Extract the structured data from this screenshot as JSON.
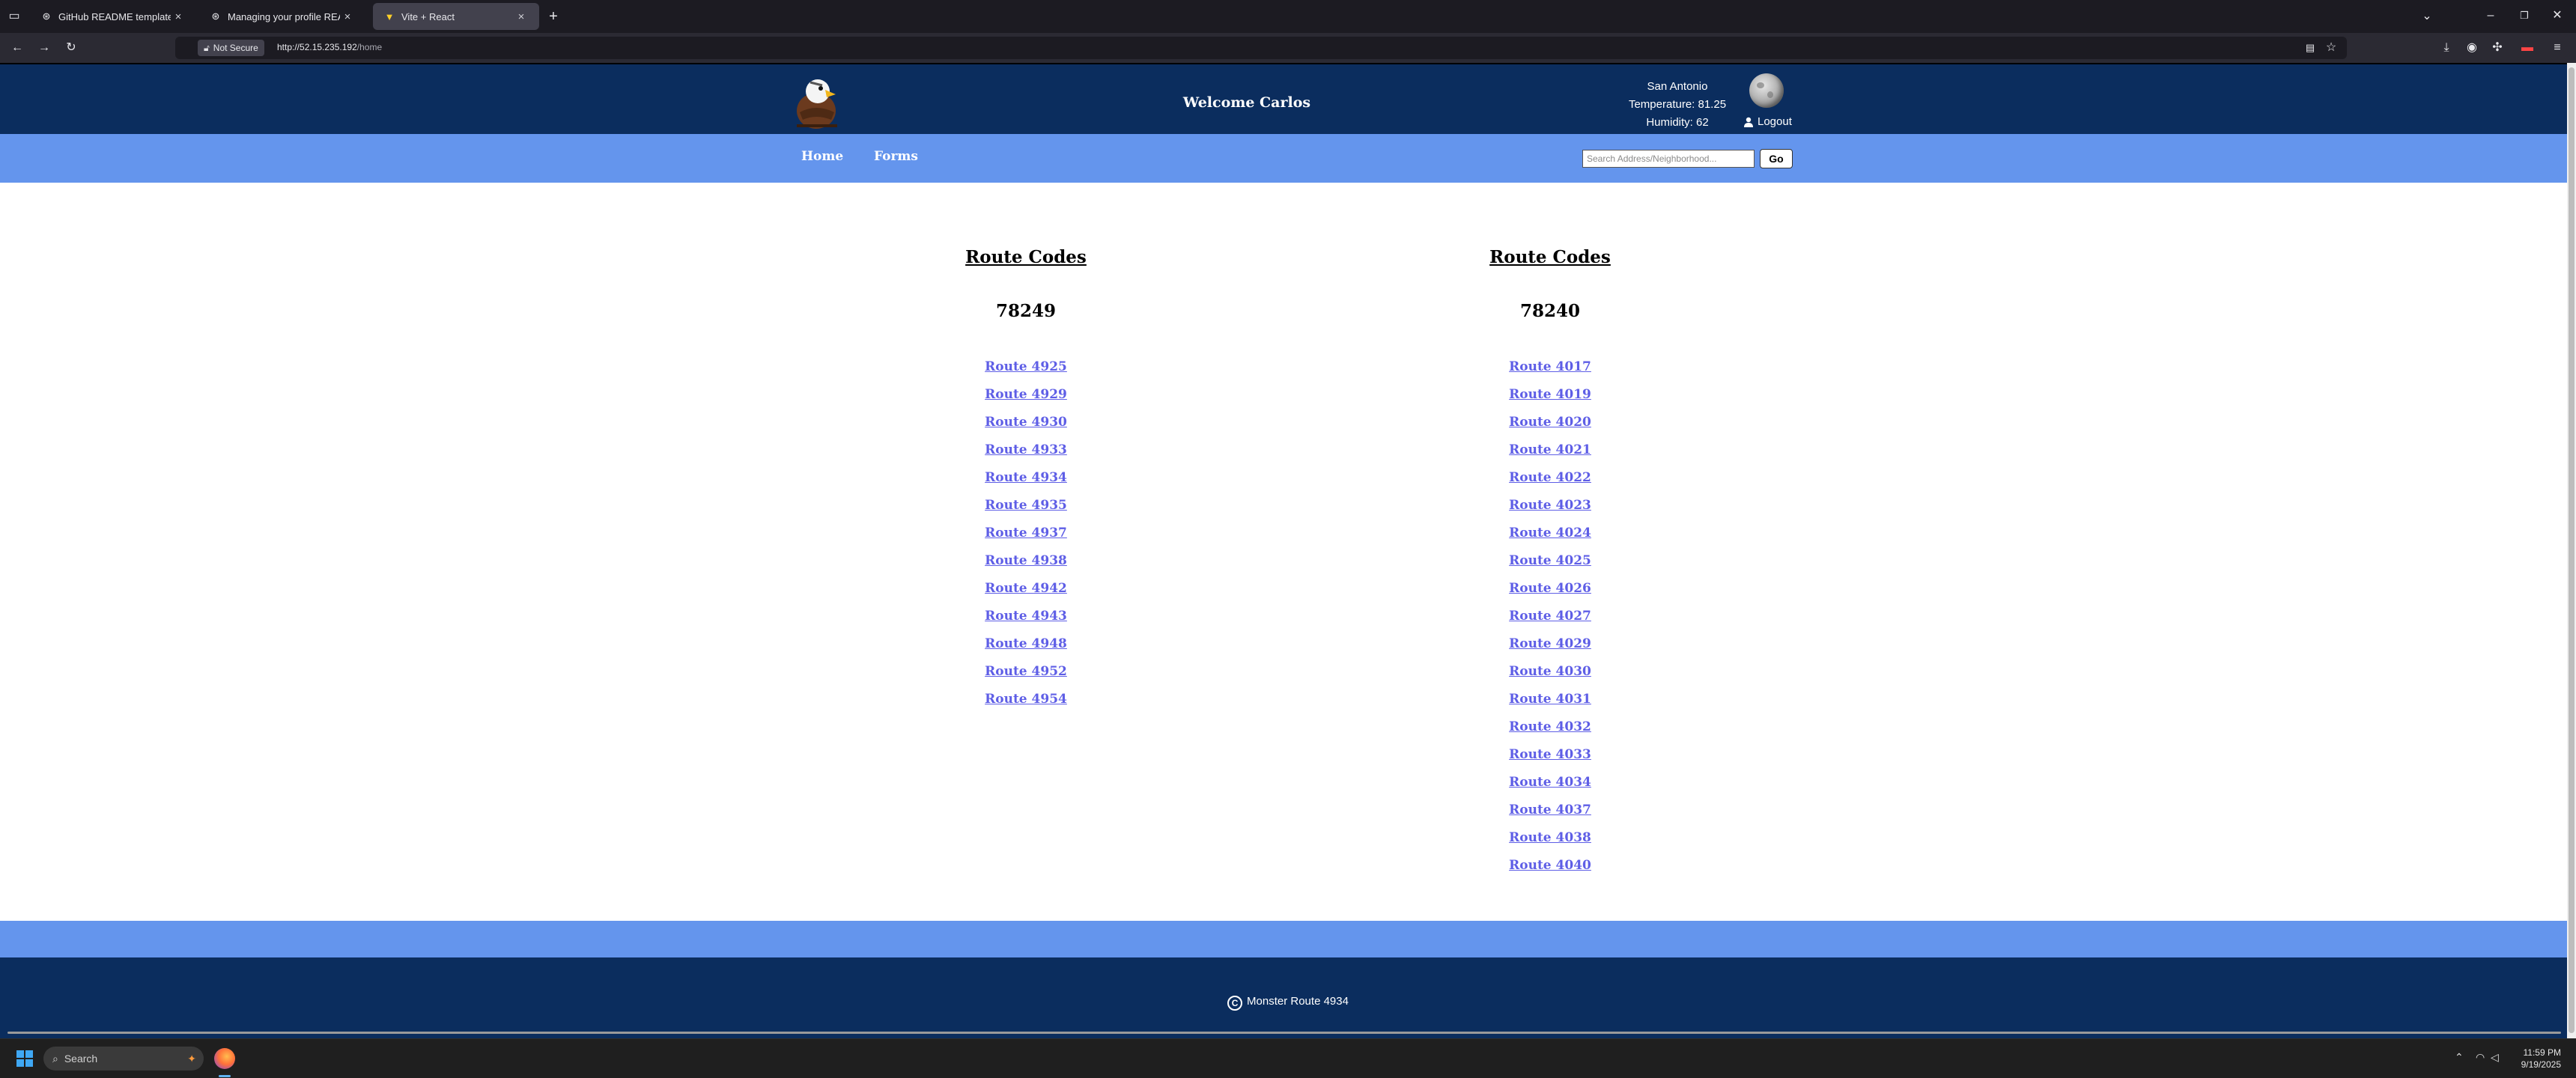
{
  "browser": {
    "tabs": [
      {
        "label": "GitHub README template",
        "icon": "github-icon"
      },
      {
        "label": "Managing your profile README",
        "icon": "github-icon"
      },
      {
        "label": "Vite + React",
        "icon": "vite-icon",
        "active": true
      }
    ],
    "security_label": "Not Secure",
    "url_host": "http://52.15.235.192",
    "url_path": "/home"
  },
  "header": {
    "welcome": "Welcome Carlos",
    "city": "San Antonio",
    "temperature": "Temperature: 81.25",
    "humidity": "Humidity: 62",
    "logout_label": "Logout"
  },
  "nav": {
    "links": [
      "Home",
      "Forms"
    ],
    "search_placeholder": "Search Address/Neighborhood...",
    "go_label": "Go"
  },
  "columns": [
    {
      "title": "Route Codes",
      "zip": "78249",
      "routes": [
        "Route 4925",
        "Route 4929",
        "Route 4930",
        "Route 4933",
        "Route 4934",
        "Route 4935",
        "Route 4937",
        "Route 4938",
        "Route 4942",
        "Route 4943",
        "Route 4948",
        "Route 4952",
        "Route 4954"
      ]
    },
    {
      "title": "Route Codes",
      "zip": "78240",
      "routes": [
        "Route 4017",
        "Route 4019",
        "Route 4020",
        "Route 4021",
        "Route 4022",
        "Route 4023",
        "Route 4024",
        "Route 4025",
        "Route 4026",
        "Route 4027",
        "Route 4029",
        "Route 4030",
        "Route 4031",
        "Route 4032",
        "Route 4033",
        "Route 4034",
        "Route 4037",
        "Route 4038",
        "Route 4040"
      ]
    }
  ],
  "footer": {
    "copyright_symbol": "C",
    "copyright_text": "Monster Route 4934"
  },
  "taskbar": {
    "search_label": "Search",
    "time": "11:59 PM",
    "date": "9/19/2025"
  },
  "colors": {
    "header_bg": "#0b2d5e",
    "nav_bg": "#6495ed",
    "route_link": "#5e5ee6"
  }
}
